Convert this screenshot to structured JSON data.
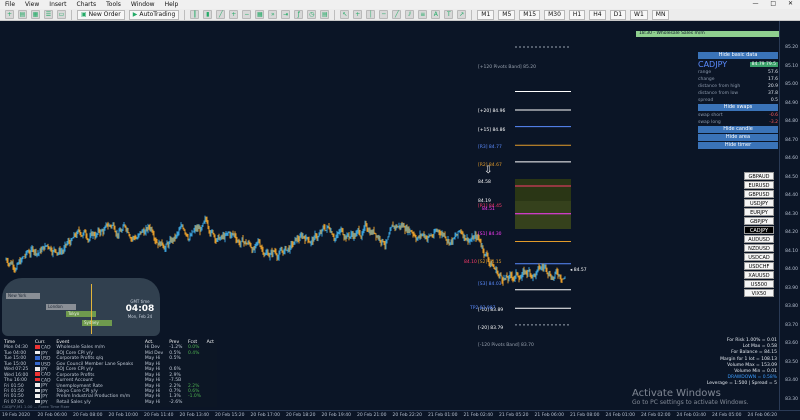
{
  "menu": {
    "items": [
      "File",
      "View",
      "Insert",
      "Charts",
      "Tools",
      "Window",
      "Help"
    ],
    "window_buttons": "— □ ✕"
  },
  "toolbar": {
    "new_order": "New Order",
    "autotrading": "AutoTrading",
    "timeframes": [
      "M1",
      "M5",
      "M15",
      "M30",
      "H1",
      "H4",
      "D1",
      "W1",
      "MN"
    ]
  },
  "chart": {
    "symbol_label": "CADJPY",
    "overlay_levels": [
      {
        "label": "[+120 Pivots Band]  85.20",
        "color": "#9aa3b0",
        "price": 85.2
      },
      {
        "label": "[+20]  84.96",
        "color": "#ffffff",
        "price": 84.96
      },
      {
        "label": "[+15]  84.86",
        "color": "#ffffff",
        "price": 84.86
      },
      {
        "label": "[R3]  84.77",
        "color": "#5b8cff",
        "price": 84.77
      },
      {
        "label": "[R2]  84.67",
        "color": "#e39b2a",
        "price": 84.67
      },
      {
        "label": "84.58",
        "color": "#ffffff",
        "price": 84.58
      },
      {
        "label": "[R1]  84.45",
        "color": "#ff3b6b",
        "price": 84.45
      },
      {
        "label": "[S1]  84.30",
        "color": "#ff3bff",
        "price": 84.3
      },
      {
        "label": "[S2]  84.15",
        "color": "#e39b2a",
        "price": 84.15
      },
      {
        "label": "[S3]  84.03",
        "color": "#5b8cff",
        "price": 84.03
      },
      {
        "label": "[-10]  83.89",
        "color": "#ffffff",
        "price": 83.89
      },
      {
        "label": "[-20]  83.79",
        "color": "#ffffff",
        "price": 83.79
      },
      {
        "label": "[-120 Pivots Band]  83.70",
        "color": "#9aa3b0",
        "price": 83.7
      }
    ],
    "small_labels": [
      "84.51",
      "TP2  83.987",
      "84.10",
      "84.19"
    ],
    "current_price_label": "84.57",
    "wholesale_banner": "18:30 - Wholesale Sales m/m"
  },
  "price_scale": {
    "labels": [
      "85.20",
      "85.10",
      "85.00",
      "84.90",
      "84.80",
      "84.70",
      "84.60",
      "84.50",
      "84.40",
      "84.30",
      "84.20",
      "84.10",
      "84.00",
      "83.90",
      "83.80",
      "83.70",
      "83.60",
      "83.50",
      "83.40",
      "83.30"
    ]
  },
  "time_scale": {
    "labels": [
      "19 Feb 2020",
      "20 Feb 06:00",
      "20 Feb 08:00",
      "20 Feb 10:00",
      "20 Feb 11:40",
      "20 Feb 13:40",
      "20 Feb 15:20",
      "20 Feb 17:00",
      "20 Feb 18:20",
      "20 Feb 19:40",
      "20 Feb 21:00",
      "20 Feb 22:20",
      "21 Feb 01:00",
      "21 Feb 02:40",
      "21 Feb 05:20",
      "21 Feb 06:00",
      "21 Feb 08:00",
      "24 Feb 01:00",
      "24 Feb 02:00",
      "24 Feb 03:40",
      "24 Feb 05:00",
      "24 Feb 06:20"
    ]
  },
  "info_panel": {
    "hide_basic_data": "Hide basic data",
    "symbol": "CADJPY",
    "rows": [
      {
        "label": "range",
        "value": "57.6"
      },
      {
        "label": "change",
        "value": "17.6"
      },
      {
        "label": "distance from high",
        "value": "20.9"
      },
      {
        "label": "distance from low",
        "value": "37.8"
      },
      {
        "label": "spread",
        "value": "0.5"
      }
    ],
    "hide_swaps": "Hide swaps",
    "swap_rows": [
      {
        "label": "swap short",
        "value": "-0.6"
      },
      {
        "label": "swap long",
        "value": "-3.2"
      }
    ],
    "hide_candle": "Hide candle",
    "hide_area": "Hide area",
    "hide_timer": "Hide timer",
    "red_value": "84.79  79.5"
  },
  "pairs": [
    "GBPAUD",
    "EURUSD",
    "GBPUSD",
    "USDJPY",
    "EURJPY",
    "GBPJPY",
    "CADJPY",
    "AUDUSD",
    "NZDUSD",
    "USDCAD",
    "USDCHF",
    "XAUUSD",
    "US500",
    "VIX50"
  ],
  "active_pair": "CADJPY",
  "clock": {
    "label": "GMT time",
    "time": "04:08",
    "date": "Mon, Feb 24"
  },
  "map_sessions": [
    "New York",
    "London",
    "Tokyo",
    "Sydney"
  ],
  "calendar": {
    "headers": [
      "Time",
      "Curr.",
      "Event",
      "Act.",
      "Prev",
      "Fcst",
      "Act"
    ],
    "rows": [
      [
        "Mon 04:30",
        "CAD",
        "Wholesale Sales m/m",
        "Hi Dev",
        "-1.2%",
        "0.0%",
        ""
      ],
      [
        "Tue 04:00",
        "JPY",
        "BOJ Core CPI y/y",
        "Mid Dev",
        "0.5%",
        "0.4%",
        ""
      ],
      [
        "Tue 15:00",
        "USD",
        "Corporate Profits q/q",
        "May Hi",
        "0.5%",
        "",
        ""
      ],
      [
        "Tue 15:00",
        "USD",
        "Gov Council Member Lane Speaks",
        "May Hi",
        "",
        "",
        ""
      ],
      [
        "Wed 07:25",
        "JPY",
        "BOJ Core CPI y/y",
        "May Hi",
        "0.6%",
        "",
        ""
      ],
      [
        "Wed 16:00",
        "CAD",
        "Corporate Profits",
        "May Hi",
        "2.9%",
        "",
        ""
      ],
      [
        "Thu 16:00",
        "CAD",
        "Current Account",
        "May Hi",
        "-7.5B",
        "",
        ""
      ],
      [
        "Fri 01:50",
        "JPY",
        "Unemployment Rate",
        "May Hi",
        "2.2%",
        "2.2%",
        ""
      ],
      [
        "Fri 01:50",
        "JPY",
        "Tokyo Core CPI y/y",
        "May Hi",
        "0.7%",
        "0.6%",
        ""
      ],
      [
        "Fri 01:50",
        "JPY",
        "Prelim Industrial Production m/m",
        "May Hi",
        "1.3%",
        "-1.0%",
        ""
      ],
      [
        "Fri 07:00",
        "JPY",
        "Retail Sales y/y",
        "May Hi",
        "-2.6%",
        "",
        ""
      ]
    ]
  },
  "trade_info": {
    "lines": [
      "For Risk 1.00% = 0.01",
      "Lot Max = 0.58",
      "For Balance = 84.15",
      "Margin for 1 lot = 108.13",
      "Volume Max = 153.09",
      "Volume Min = 0.01"
    ],
    "drawdown": "DRAWDOWN = 0.58%",
    "leverage": "Leverage = 1:500 | Spread = 5"
  },
  "watermark": {
    "line1": "Activate Windows",
    "line2": "Go to PC settings to activate Windows."
  },
  "status_bottom": "CADJPY,M1  1.00  ...  Forex Time Fixer",
  "colors": {
    "bg": "#0b1526",
    "candle_up": "#3aa0d8",
    "candle_down": "#e39b2a",
    "button_blue": "#3a73b8"
  }
}
